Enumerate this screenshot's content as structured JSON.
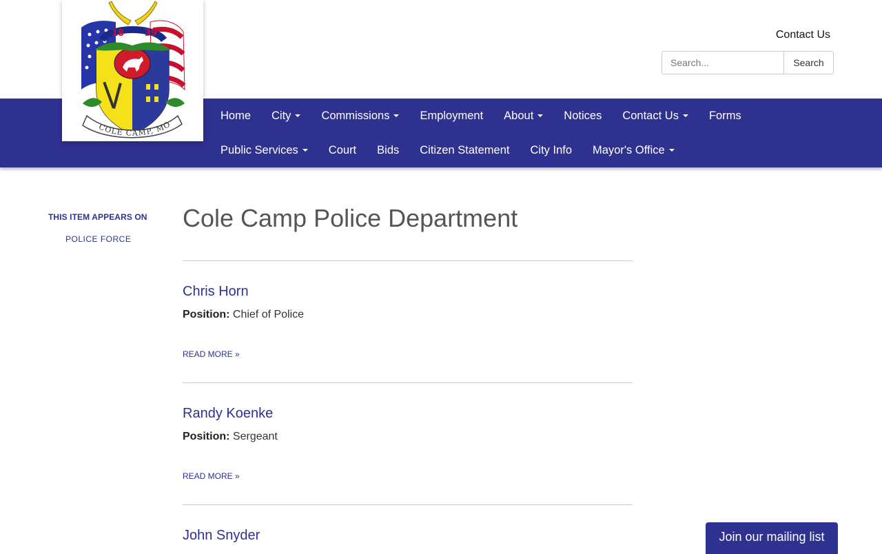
{
  "header": {
    "logo_text": "COLE CAMP, MO",
    "logo_year_left": "18",
    "logo_year_right": "39",
    "contact_link": "Contact Us",
    "search": {
      "placeholder": "Search...",
      "button_label": "Search"
    }
  },
  "nav": {
    "row1": [
      {
        "label": "Home",
        "dropdown": false
      },
      {
        "label": "City",
        "dropdown": true
      },
      {
        "label": "Commissions",
        "dropdown": true
      },
      {
        "label": "Employment",
        "dropdown": false
      },
      {
        "label": "About",
        "dropdown": true
      },
      {
        "label": "Notices",
        "dropdown": false
      },
      {
        "label": "Contact Us",
        "dropdown": true
      },
      {
        "label": "Forms",
        "dropdown": false
      }
    ],
    "row2": [
      {
        "label": "Public Services",
        "dropdown": true
      },
      {
        "label": "Court",
        "dropdown": false
      },
      {
        "label": "Bids",
        "dropdown": false
      },
      {
        "label": "Citizen Statement",
        "dropdown": false
      },
      {
        "label": "City Info",
        "dropdown": false
      },
      {
        "label": "Mayor's Office",
        "dropdown": true
      }
    ]
  },
  "sidebar": {
    "title": "THIS ITEM APPEARS ON",
    "link": "POLICE FORCE"
  },
  "main": {
    "title": "Cole Camp Police Department",
    "position_label": "Position:",
    "read_more": "READ MORE »",
    "people": [
      {
        "name": "Chris Horn",
        "position": "Chief of Police"
      },
      {
        "name": "Randy Koenke",
        "position": "Sergeant"
      },
      {
        "name": "John Snyder",
        "position": ""
      }
    ]
  },
  "mailing": {
    "label": "Join our mailing list"
  },
  "colors": {
    "brand": "#2e3190",
    "title_gray": "#555555",
    "divider": "#cccccc"
  }
}
